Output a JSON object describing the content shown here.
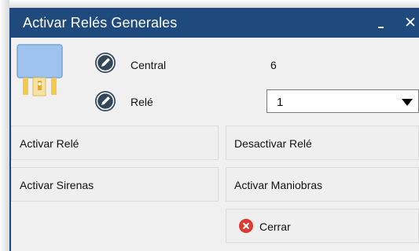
{
  "window": {
    "title": "Activar Relés Generales",
    "minimize_label": "_",
    "colors": {
      "titlebar": "#1f4a7d",
      "body": "#f0f0f0",
      "close_icon": "#e03a2e"
    }
  },
  "form": {
    "central_label": "Central",
    "central_value": "6",
    "rele_label": "Relé",
    "rele_selected": "1"
  },
  "buttons": {
    "activar_rele": "Activar Relé",
    "desactivar_rele": "Desactivar Relé",
    "activar_sirenas": "Activar Sirenas",
    "activar_maniobras": "Activar Maniobras",
    "cerrar": "Cerrar"
  },
  "icons": {
    "relay": "relay-icon",
    "edit": "pencil-circle-icon",
    "dropdown": "triangle-down-icon",
    "close": "red-x-circle-icon"
  }
}
